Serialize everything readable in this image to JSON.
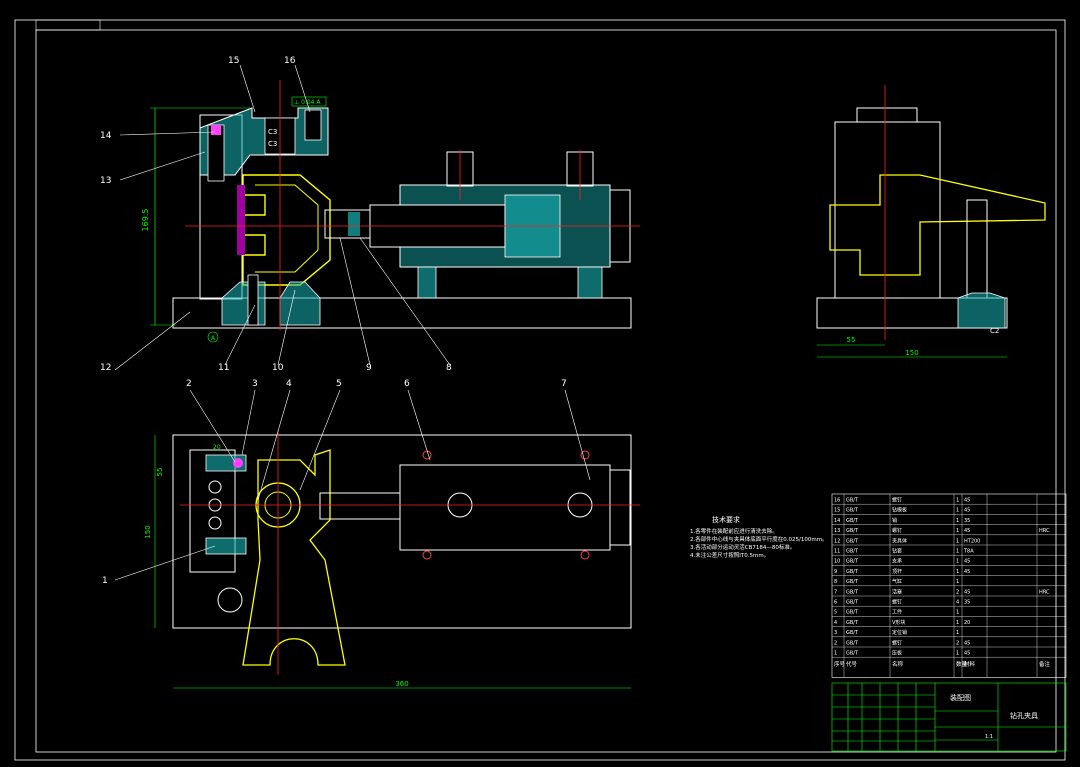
{
  "balloons": {
    "b1": "1",
    "b2": "2",
    "b3": "3",
    "b4": "4",
    "b5": "5",
    "b6": "6",
    "b7": "7",
    "b8": "8",
    "b9": "9",
    "b10": "10",
    "b11": "11",
    "b12": "12",
    "b13": "13",
    "b14": "14",
    "b15": "15",
    "b16": "16"
  },
  "dims": {
    "height_front": "169.5",
    "width_top": "360",
    "height_top": "150",
    "top_offset": "55",
    "small_20": "20",
    "side_55": "55",
    "side_150": "150",
    "chamfer_c1": "C3",
    "chamfer_c2": "C3",
    "chamfer_c3": "C2",
    "datum": "A",
    "tol_frame": "⊥ 0.04 A"
  },
  "tech_notes": {
    "title": "技术要求",
    "lines": [
      "1.各零件在装配前应进行清洗去除。",
      "2.各部件中心线与夹具体底面平行度在0.025/100mm。",
      "3.各活动部分运动灵活CB7184—80标准。",
      "4.未注公差尺寸按照IT0.5mm。"
    ]
  },
  "bom": {
    "rows": [
      [
        "16",
        "GB/T",
        "螺钉",
        "1",
        "45",
        ""
      ],
      [
        "15",
        "GB/T",
        "钻模板",
        "1",
        "45",
        ""
      ],
      [
        "14",
        "GB/T",
        "销",
        "1",
        "35",
        ""
      ],
      [
        "13",
        "GB/T",
        "螺钉",
        "1",
        "45",
        "HRC"
      ],
      [
        "12",
        "GB/T",
        "夹具体",
        "1",
        "HT200",
        ""
      ],
      [
        "11",
        "GB/T",
        "钻套",
        "1",
        "T8A",
        ""
      ],
      [
        "10",
        "GB/T",
        "支承",
        "1",
        "45",
        ""
      ],
      [
        "9",
        "GB/T",
        "顶杆",
        "1",
        "45",
        ""
      ],
      [
        "8",
        "GB/T",
        "气缸",
        "1",
        "",
        ""
      ],
      [
        "7",
        "GB/T",
        "活塞",
        "2",
        "45",
        "HRC"
      ],
      [
        "6",
        "GB/T",
        "螺钉",
        "4",
        "35",
        ""
      ],
      [
        "5",
        "GB/T",
        "工件",
        "1",
        "",
        ""
      ],
      [
        "4",
        "GB/T",
        "V形块",
        "1",
        "20",
        ""
      ],
      [
        "3",
        "GB/T",
        "定位销",
        "1",
        "",
        ""
      ],
      [
        "2",
        "GB/T",
        "螺钉",
        "2",
        "45",
        ""
      ],
      [
        "1",
        "GB/T",
        "压板",
        "1",
        "45",
        ""
      ]
    ],
    "header": [
      "序号",
      "代号",
      "名称",
      "数量",
      "材料",
      "备注"
    ]
  },
  "title_block": {
    "drawing_name": "装配图",
    "product_name": "钻孔夹具",
    "scale": "1:1"
  }
}
